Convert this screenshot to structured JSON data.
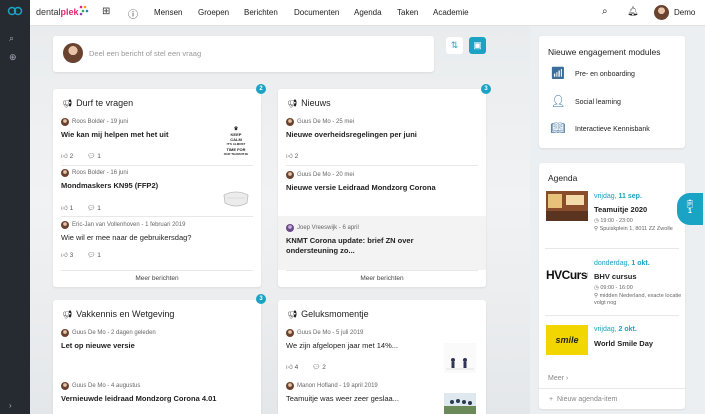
{
  "topbar": {
    "brand_prefix": "dental",
    "brand_suffix": "plek",
    "nav": [
      "Mensen",
      "Groepen",
      "Berichten",
      "Documenten",
      "Agenda",
      "Taken",
      "Academie"
    ],
    "user_name": "Demo"
  },
  "compose": {
    "placeholder": "Deel een bericht of stel een vraag"
  },
  "panels": {
    "durf": {
      "title": "Durf te vragen",
      "badge": "2",
      "posts": [
        {
          "author": "Roos Bolder",
          "date": "19 juni",
          "title": "Wie kan mij helpen met het uit",
          "likes": "2",
          "comments": "1"
        },
        {
          "author": "Roos Bolder",
          "date": "16 juni",
          "title": "Mondmaskers KN95 (FFP2)",
          "likes": "1",
          "comments": "1"
        },
        {
          "author": "Eric-Jan van Vollenhoven",
          "date": "1 februari 2019",
          "text": "Wie wil er mee naar de gebruikersdag?",
          "likes": "3",
          "comments": "1"
        }
      ],
      "more": "Meer berichten",
      "thumb_text": [
        "KEEP",
        "CALM",
        "IT'S ALMOST",
        "TIME FOR",
        "OUR TEAMUITJE"
      ]
    },
    "nieuws": {
      "title": "Nieuws",
      "badge": "3",
      "posts": [
        {
          "author": "Guus De Mo",
          "date": "25 mei",
          "title": "Nieuwe overheidsregelingen per juni",
          "likes": "2"
        },
        {
          "author": "Guus De Mo",
          "date": "20 mei",
          "title": "Nieuwe versie Leidraad Mondzorg Corona"
        },
        {
          "author": "Joep Vreeswijk",
          "date": "6 april",
          "title": "KNMT Corona update: brief ZN over ondersteuning zo..."
        }
      ],
      "more": "Meer berichten"
    },
    "vak": {
      "title": "Vakkennis en Wetgeving",
      "badge": "3",
      "posts": [
        {
          "author": "Guus De Mo",
          "date": "2 dagen geleden",
          "title": "Let op nieuwe versie"
        },
        {
          "author": "Guus De Mo",
          "date": "4 augustus",
          "title": "Vernieuwde leidraad Mondzorg Corona 4.01"
        }
      ]
    },
    "geluk": {
      "title": "Geluksmomentje",
      "posts": [
        {
          "author": "Guus De Mo",
          "date": "5 juli 2019",
          "text": "We zijn afgelopen jaar met 14%...",
          "likes": "4",
          "comments": "2"
        },
        {
          "author": "Manon Hofland",
          "date": "19 april 2019",
          "text": "Teamuitje was weer zeer geslaa..."
        }
      ]
    }
  },
  "modules": {
    "title": "Nieuwe engagement modules",
    "items": [
      "Pre- en onboarding",
      "Social learning",
      "Interactieve Kennisbank"
    ]
  },
  "agenda": {
    "title": "Agenda",
    "items": [
      {
        "day": "vrijdag,",
        "date": "11 sep.",
        "title": "Teamuitje 2020",
        "time": "19:00 - 23:00",
        "loc": "Spuiskplein 1, 8011 ZZ Zwolle"
      },
      {
        "day": "donderdag,",
        "date": "1 okt.",
        "title": "BHV cursus",
        "time": "09:00 - 16:00",
        "loc": "midden Nederland, exacte locatie volgt nog",
        "img_text": "HVCursu"
      },
      {
        "day": "vrijdag,",
        "date": "2 okt.",
        "title": "World Smile Day",
        "img_text": "smile"
      }
    ],
    "more": "Meer",
    "new_item": "Nieuw agenda-item"
  },
  "fab": {
    "count": "1"
  },
  "colors": {
    "accent": "#1aa3c4",
    "rail": "#262b31",
    "brand": "#e0266d"
  }
}
